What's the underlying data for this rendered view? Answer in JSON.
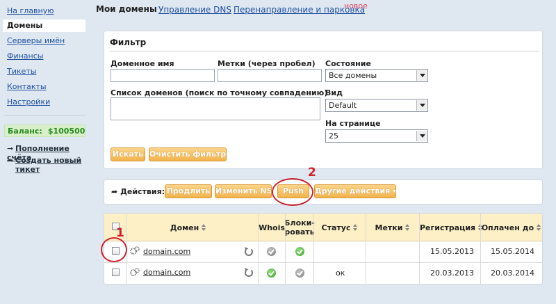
{
  "sidebar": {
    "home": "На главную",
    "domains": "Домены",
    "name_servers": "Серверы имён",
    "finance": "Финансы",
    "tickets": "Тикеты",
    "contacts": "Контакты",
    "settings": "Настройки",
    "balance_label": "Баланс:",
    "balance_value": "$100500",
    "topup": "Пополнение счёта",
    "new_ticket_1": "Создать новый",
    "new_ticket_2": "тикет"
  },
  "tabs": {
    "my_domains": "Мои домены",
    "dns": "Управление DNS",
    "redirect": "Перенаправление и парковка",
    "new_badge": "новое"
  },
  "filter": {
    "title": "Фильтр",
    "domain_name_label": "Доменное имя",
    "domain_name_value": "",
    "tags_label": "Метки (через пробел)",
    "tags_value": "",
    "status_label": "Состояние",
    "status_value": "Все домены",
    "list_label": "Список доменов (поиск по точному совпадению)",
    "list_value": "",
    "view_label": "Вид",
    "view_value": "Default",
    "per_page_label": "На странице",
    "per_page_value": "25",
    "search_button": "Искать",
    "clear_button": "Очистить фильтр"
  },
  "actions": {
    "label": "Действия:",
    "renew": "Продлить",
    "change_ns": "Изменить NS",
    "push": "Push",
    "other": "Другие действия"
  },
  "table": {
    "headers": {
      "domain": "Домен",
      "whois": "Whois",
      "block_1": "Блоки-",
      "block_2": "ровать",
      "status": "Статус",
      "tags": "Метки",
      "registration": "Регистрация",
      "paid_until": "Оплачен до"
    },
    "rows": [
      {
        "domain": "domain.com",
        "whois": "grey",
        "block": "green",
        "status": "",
        "tags": "",
        "registration": "15.05.2013",
        "paid_until": "15.05.2014"
      },
      {
        "domain": "domain.com",
        "whois": "green",
        "block": "grey",
        "status": "ок",
        "tags": "",
        "registration": "20.03.2013",
        "paid_until": "20.03.2014"
      }
    ]
  },
  "annotations": {
    "one": "1",
    "two": "2",
    "color": "#d2202a"
  },
  "colors": {
    "accent_button": "#f2b34c",
    "link": "#1f4fa0",
    "balance": "#2a8a20",
    "new_badge": "#d9455f"
  }
}
